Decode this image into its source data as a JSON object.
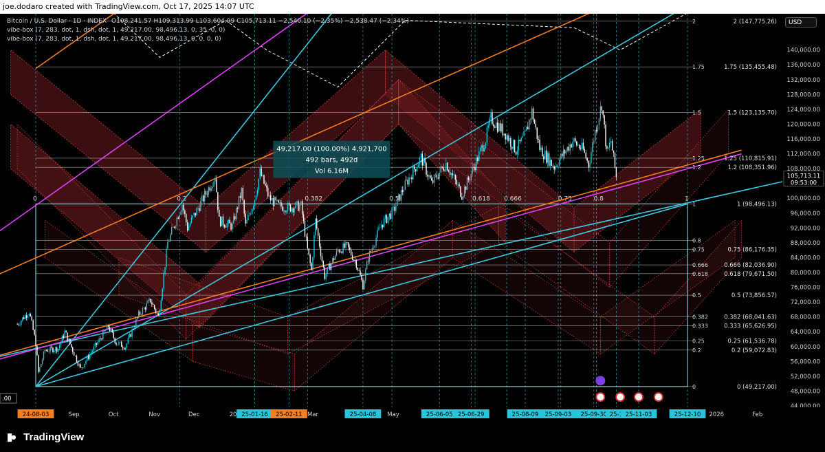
{
  "header": {
    "credit": "joe.dodaro created with TradingView.com, Oct 17, 2025 14:07 UTC"
  },
  "legend": {
    "symbol": "Bitcoin / U.S. Dollar · 1D · INDEX",
    "ohlc": "O108,241.57 H109,313.99 L103,604.99 C105,713.11 −2,540.10 (−2.35%)  −2,538.47 (−2.34%)",
    "indicator1": "vibe-box (7, 283, dot, 1, dsh, dot, 1, 49,217.00, 98,496.13, 0, 35, 0, 0)",
    "indicator2": "vibe-box (7, 283, dot, 1, dsh, dot, 1, 49,217.00, 98,496.13, 0, 0, 0, 0)"
  },
  "currency": "USD",
  "brand": "TradingView",
  "colors": {
    "background": "#000000",
    "candle_up": "#26c6da",
    "candle_down": "#ffffff",
    "cyan_line": "#3cc8dc",
    "orange_line": "#f57c1f",
    "magenta_line": "#e040fb",
    "box_fill": "#6b1a1f",
    "box_border": "#c43a3a",
    "fib_line": "#cfd8dc"
  },
  "chart_data": {
    "type": "candlestick",
    "title": "Bitcoin / U.S. Dollar · 1D · INDEX",
    "ylim": [
      44000,
      152000
    ],
    "y_ticks": [
      44000,
      48000,
      52000,
      56000,
      60000,
      64000,
      68000,
      72000,
      76000,
      80000,
      84000,
      88000,
      92000,
      96000,
      100000,
      104000,
      108000,
      112000,
      116000,
      120000,
      124000,
      128000,
      132000,
      136000,
      140000
    ],
    "y_tick_labels": [
      "44,000.00",
      "48,000.00",
      "52,000.00",
      "56,000.00",
      "60,000.00",
      "64,000.00",
      "68,000.00",
      "72,000.00",
      "76,000.00",
      "80,000.00",
      "84,000.00",
      "88,000.00",
      "92,000.00",
      "96,000.00",
      "100,000.00",
      "104,000.00",
      "108,000.00",
      "112,000.00",
      "116,000.00",
      "120,000.00",
      "124,000.00",
      "128,000.00",
      "132,000.00",
      "136,000.00",
      "140,000.00"
    ],
    "x_labels": [
      {
        "date": "2024-08-03",
        "label": "24-08-03",
        "highlight": "orange"
      },
      {
        "date": "2024-09-01",
        "label": "Sep"
      },
      {
        "date": "2024-10-01",
        "label": "Oct"
      },
      {
        "date": "2024-11-01",
        "label": "Nov"
      },
      {
        "date": "2024-12-01",
        "label": "Dec"
      },
      {
        "date": "2025-01-01",
        "label": "202"
      },
      {
        "date": "2025-01-16",
        "label": "25-01-16",
        "highlight": "cyan"
      },
      {
        "date": "2025-02-11",
        "label": "25-02-11",
        "highlight": "orange"
      },
      {
        "date": "2025-03-01",
        "label": "Mar"
      },
      {
        "date": "2025-04-08",
        "label": "25-04-08",
        "highlight": "cyan"
      },
      {
        "date": "2025-05-01",
        "label": "May"
      },
      {
        "date": "2025-06-05",
        "label": "25-06-05",
        "highlight": "cyan"
      },
      {
        "date": "2025-06-29",
        "label": "25-06-29",
        "highlight": "cyan"
      },
      {
        "date": "2025-08-09",
        "label": "25-08-09",
        "highlight": "cyan"
      },
      {
        "date": "2025-09-03",
        "label": "25-09-03",
        "highlight": "cyan"
      },
      {
        "date": "2025-09-30",
        "label": "25-09-30",
        "highlight": "cyan"
      },
      {
        "date": "2025-10-17",
        "label": "25-1",
        "highlight": "cyan"
      },
      {
        "date": "2025-11-03",
        "label": "25-11-03",
        "highlight": "cyan"
      },
      {
        "date": "2025-12-10",
        "label": "25-12-10",
        "highlight": "cyan"
      },
      {
        "date": "2026-01-01",
        "label": "2026"
      },
      {
        "date": "2026-02-01",
        "label": "Feb"
      }
    ],
    "price_path": [
      [
        "2024-07-20",
        66000
      ],
      [
        "2024-07-29",
        69500
      ],
      [
        "2024-08-03",
        61000
      ],
      [
        "2024-08-05",
        53000
      ],
      [
        "2024-08-10",
        59000
      ],
      [
        "2024-08-20",
        59500
      ],
      [
        "2024-08-25",
        64000
      ],
      [
        "2024-09-06",
        54000
      ],
      [
        "2024-09-15",
        59000
      ],
      [
        "2024-09-27",
        65500
      ],
      [
        "2024-10-03",
        61000
      ],
      [
        "2024-10-10",
        60000
      ],
      [
        "2024-10-20",
        68500
      ],
      [
        "2024-10-29",
        72500
      ],
      [
        "2024-11-04",
        68000
      ],
      [
        "2024-11-11",
        88000
      ],
      [
        "2024-11-22",
        98500
      ],
      [
        "2024-11-26",
        92000
      ],
      [
        "2024-12-05",
        98000
      ],
      [
        "2024-12-17",
        106000
      ],
      [
        "2024-12-20",
        94000
      ],
      [
        "2024-12-30",
        92500
      ],
      [
        "2025-01-06",
        102000
      ],
      [
        "2025-01-09",
        92500
      ],
      [
        "2025-01-16",
        100000
      ],
      [
        "2025-01-20",
        107000
      ],
      [
        "2025-01-27",
        100000
      ],
      [
        "2025-02-03",
        98000
      ],
      [
        "2025-02-11",
        97500
      ],
      [
        "2025-02-20",
        98000
      ],
      [
        "2025-02-25",
        86000
      ],
      [
        "2025-02-28",
        80500
      ],
      [
        "2025-03-03",
        94000
      ],
      [
        "2025-03-10",
        79000
      ],
      [
        "2025-03-20",
        86000
      ],
      [
        "2025-03-27",
        87000
      ],
      [
        "2025-04-03",
        82500
      ],
      [
        "2025-04-08",
        76500
      ],
      [
        "2025-04-12",
        84000
      ],
      [
        "2025-04-22",
        93000
      ],
      [
        "2025-05-01",
        96500
      ],
      [
        "2025-05-09",
        103000
      ],
      [
        "2025-05-22",
        111000
      ],
      [
        "2025-05-30",
        104000
      ],
      [
        "2025-06-10",
        109500
      ],
      [
        "2025-06-22",
        101000
      ],
      [
        "2025-06-30",
        107500
      ],
      [
        "2025-07-10",
        116000
      ],
      [
        "2025-07-14",
        121500
      ],
      [
        "2025-07-25",
        117500
      ],
      [
        "2025-08-02",
        113000
      ],
      [
        "2025-08-09",
        117000
      ],
      [
        "2025-08-14",
        123500
      ],
      [
        "2025-08-20",
        113500
      ],
      [
        "2025-08-31",
        108500
      ],
      [
        "2025-09-05",
        111000
      ],
      [
        "2025-09-14",
        115500
      ],
      [
        "2025-09-22",
        113000
      ],
      [
        "2025-09-26",
        109000
      ],
      [
        "2025-10-01",
        118000
      ],
      [
        "2025-10-06",
        125500
      ],
      [
        "2025-10-10",
        112000
      ],
      [
        "2025-10-13",
        115500
      ],
      [
        "2025-10-17",
        105713
      ]
    ],
    "last_price": "105,713.11",
    "countdown": "09:53:00",
    "levels": [
      {
        "ratio": "2",
        "price": 147775.26,
        "label": "2 (147,775.26)"
      },
      {
        "ratio": "1.75",
        "price": 135455.48,
        "label": "1.75 (135,455.48)"
      },
      {
        "ratio": "1.5",
        "price": 123135.7,
        "label": "1.5 (123,135.70)"
      },
      {
        "ratio": "1.25",
        "price": 110815.91,
        "label": "1.25 (110,815.91)"
      },
      {
        "ratio": "1.2",
        "price": 108351.96,
        "label": "1.2 (108,351.96)"
      },
      {
        "ratio": "1",
        "price": 98496.13,
        "label": "1 (98,496.13)"
      },
      {
        "ratio": "0.8",
        "price": 88640.3,
        "label": ""
      },
      {
        "ratio": "0.75",
        "price": 86176.35,
        "label": "0.75 (86,176.35)"
      },
      {
        "ratio": "0.666",
        "price": 82036.9,
        "label": "0.666 (82,036.90)"
      },
      {
        "ratio": "0.618",
        "price": 79671.5,
        "label": "0.618 (79,671.50)"
      },
      {
        "ratio": "0.5",
        "price": 73856.57,
        "label": "0.5 (73,856.57)"
      },
      {
        "ratio": "0.382",
        "price": 68041.63,
        "label": "0.382 (68,041.63)"
      },
      {
        "ratio": "0.333",
        "price": 65626.95,
        "label": "0.333 (65,626.95)"
      },
      {
        "ratio": "0.25",
        "price": 61536.78,
        "label": "0.25 (61,536.78)"
      },
      {
        "ratio": "0.2",
        "price": 59072.83,
        "label": "0.2 (59,072.83)"
      },
      {
        "ratio": "0",
        "price": 49217.0,
        "label": "0 (49,217.00)"
      }
    ],
    "time_fibs": [
      {
        "label": "0",
        "date": "2024-08-03"
      },
      {
        "label": "0.2",
        "date": "2024-11-20"
      },
      {
        "label": "0.382",
        "date": "2025-02-25"
      },
      {
        "label": "0.5",
        "date": "2025-04-30"
      },
      {
        "label": "0.618",
        "date": "2025-07-02"
      },
      {
        "label": "0.666",
        "date": "2025-07-26"
      },
      {
        "label": "0.75",
        "date": "2025-09-05"
      },
      {
        "label": "0.8",
        "date": "2025-10-02"
      },
      {
        "label": "1",
        "date": "2025-12-10"
      }
    ],
    "measure_box": {
      "line1": "49,217.00 (100.00%) 4,921,700",
      "line2": "492 bars, 492d",
      "line3": "Vol 6.16M"
    },
    "fib_box": {
      "start": "2024-08-03",
      "end": "2025-12-10",
      "low": 49217.0,
      "high": 98496.13
    },
    "trendlines": [
      {
        "color": "cyan",
        "from": [
          "2024-08-03",
          49217
        ],
        "to": [
          "2025-12-10",
          98496
        ]
      },
      {
        "color": "cyan",
        "from": [
          "2024-08-03",
          49217
        ],
        "to": [
          "2025-03-20",
          152000
        ]
      },
      {
        "color": "cyan",
        "from": [
          "2024-08-03",
          49217
        ],
        "to": [
          "2025-12-10",
          152000
        ]
      },
      {
        "color": "cyan",
        "from": [
          "2024-06-20",
          56000
        ],
        "to": [
          "2026-02-20",
          104500
        ]
      },
      {
        "color": "magenta",
        "from": [
          "2024-06-20",
          55000
        ],
        "to": [
          "2026-01-20",
          112000
        ]
      },
      {
        "color": "magenta",
        "from": [
          "2024-06-20",
          87000
        ],
        "to": [
          "2025-03-05",
          152000
        ]
      },
      {
        "color": "orange",
        "from": [
          "2024-06-20",
          56000
        ],
        "to": [
          "2026-01-20",
          113000
        ]
      },
      {
        "color": "orange",
        "from": [
          "2024-06-20",
          77000
        ],
        "to": [
          "2025-10-10",
          152000
        ]
      },
      {
        "color": "orange",
        "from": [
          "2024-08-03",
          135000
        ],
        "to": [
          "2024-10-10",
          152000
        ]
      }
    ],
    "zigzag_channels": [
      {
        "points": [
          [
            "2024-07-15",
            128000
          ],
          [
            "2024-12-10",
            85500
          ],
          [
            "2025-04-25",
            128000
          ],
          [
            "2025-09-15",
            85500
          ],
          [
            "2025-12-20",
            112000
          ]
        ],
        "width": 12000,
        "style": "fill"
      },
      {
        "points": [
          [
            "2024-07-15",
            108000
          ],
          [
            "2024-12-05",
            65000
          ],
          [
            "2025-05-05",
            120000
          ],
          [
            "2025-07-25",
            88000
          ]
        ],
        "width": 12000,
        "style": "fill"
      },
      {
        "points": [
          [
            "2024-07-20",
            108000
          ],
          [
            "2024-11-25",
            62000
          ],
          [
            "2025-05-05",
            120000
          ],
          [
            "2025-10-12",
            76000
          ],
          [
            "2026-01-10",
            112000
          ]
        ],
        "width": 12000,
        "style": "dotted"
      },
      {
        "points": [
          [
            "2024-08-10",
            84000
          ],
          [
            "2024-11-30",
            56000
          ],
          [
            "2025-02-15",
            48000
          ],
          [
            "2025-06-15",
            84000
          ],
          [
            "2025-10-05",
            58000
          ],
          [
            "2026-01-15",
            84000
          ]
        ],
        "width": 10000,
        "style": "dotted"
      },
      {
        "points": [
          [
            "2024-10-05",
            74000
          ],
          [
            "2025-02-10",
            58000
          ],
          [
            "2025-07-20",
            88000
          ],
          [
            "2025-11-15",
            58000
          ],
          [
            "2026-01-20",
            84000
          ]
        ],
        "width": 10000,
        "style": "dotted"
      },
      {
        "points": [
          [
            "2024-10-01",
            150000
          ],
          [
            "2024-11-05",
            138000
          ],
          [
            "2024-12-25",
            148000
          ],
          [
            "2025-01-25",
            140000
          ],
          [
            "2025-03-20",
            130000
          ],
          [
            "2025-05-10",
            148000
          ],
          [
            "2025-09-15",
            146000
          ],
          [
            "2025-10-20",
            140000
          ],
          [
            "2025-12-10",
            150000
          ]
        ],
        "width": 0,
        "style": "white-dashed"
      }
    ],
    "vertical_markers": [
      "2024-08-03",
      "2024-11-20",
      "2025-01-16",
      "2025-02-11",
      "2025-02-25",
      "2025-04-08",
      "2025-04-30",
      "2025-06-05",
      "2025-06-29",
      "2025-07-02",
      "2025-07-26",
      "2025-08-09",
      "2025-09-03",
      "2025-09-05",
      "2025-09-30",
      "2025-10-02",
      "2025-10-17",
      "2025-11-03",
      "2025-12-10"
    ]
  }
}
